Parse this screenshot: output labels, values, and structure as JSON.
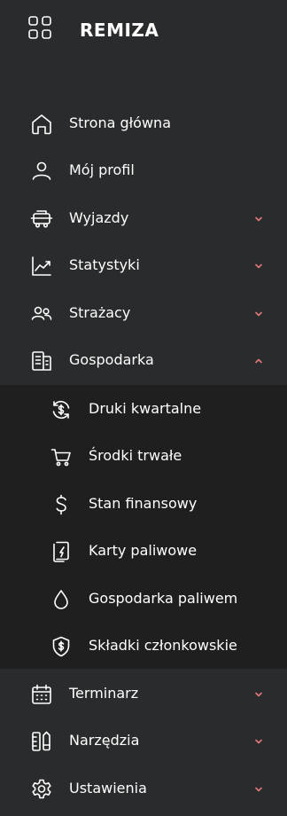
{
  "brand": {
    "title": "REMIZA",
    "icon": "grid-icon"
  },
  "accent_color": "#e07a7a",
  "menu": {
    "home": {
      "label": "Strona główna",
      "icon": "home-icon"
    },
    "profile": {
      "label": "Mój profil",
      "icon": "user-icon"
    },
    "trips": {
      "label": "Wyjazdy",
      "icon": "fire-truck-icon"
    },
    "stats": {
      "label": "Statystyki",
      "icon": "chart-line-icon"
    },
    "firefighters": {
      "label": "Strażacy",
      "icon": "users-icon"
    },
    "economy": {
      "label": "Gospodarka",
      "icon": "building-icon",
      "expanded": true
    },
    "calendar": {
      "label": "Terminarz",
      "icon": "calendar-icon"
    },
    "tools": {
      "label": "Narzędzia",
      "icon": "tools-icon"
    },
    "settings": {
      "label": "Ustawienia",
      "icon": "gear-icon"
    }
  },
  "submenu": {
    "quarterly": {
      "label": "Druki kwartalne",
      "icon": "refresh-dollar-icon"
    },
    "assets": {
      "label": "Środki trwałe",
      "icon": "cart-icon"
    },
    "finance": {
      "label": "Stan finansowy",
      "icon": "dollar-icon"
    },
    "fuel_cards": {
      "label": "Karty paliwowe",
      "icon": "fuel-card-icon"
    },
    "fuel_economy": {
      "label": "Gospodarka paliwem",
      "icon": "droplet-icon"
    },
    "fees": {
      "label": "Składki członkowskie",
      "icon": "shield-dollar-icon"
    }
  }
}
